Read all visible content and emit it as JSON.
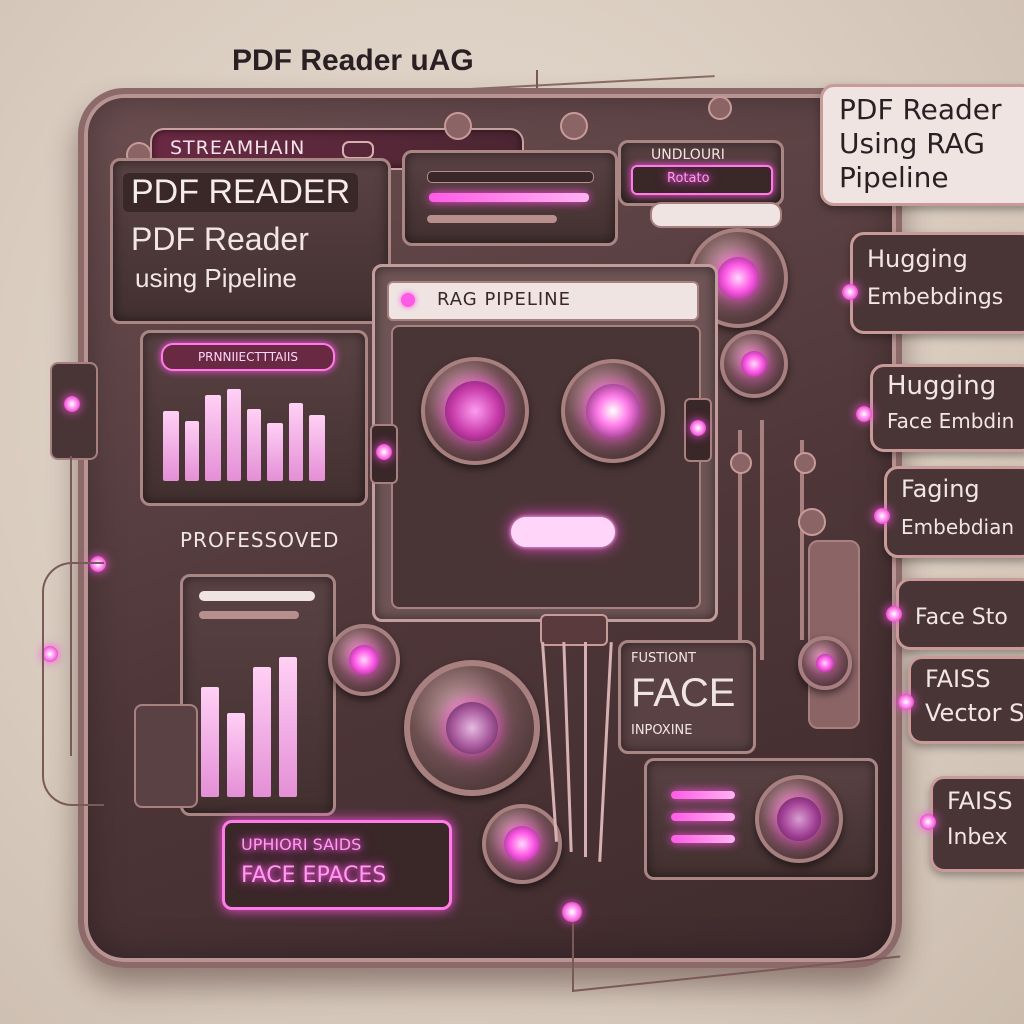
{
  "top_title": "PDF Reader uAG",
  "header": {
    "brand": "STREAMHAIN"
  },
  "title_panel": {
    "line1": "PDF READER",
    "line2": "PDF Reader",
    "line3": "using Pipeline"
  },
  "info_panel": {
    "label": "UNDLOURI",
    "button": "Rotato"
  },
  "rag_window": {
    "title": "RAG PIPELINE"
  },
  "left_widget": {
    "header": "PRNNIIECTTTAIIS",
    "label": "PROFESSOVED"
  },
  "face_panel": {
    "caption": "FUSTIONT",
    "word": "FACE",
    "sub": "INPOXINE"
  },
  "bottom_label": {
    "line1": "UPHIORI SAIDS",
    "line2": "FACE EPACES"
  },
  "side_tags": [
    {
      "line1": "PDF Reader",
      "line2": "Using RAG",
      "line3": "Pipeline"
    },
    {
      "line1": "Hugging",
      "line2": "Embebdings"
    },
    {
      "line1": "Hugging",
      "line2": "Face Embdin"
    },
    {
      "line1": "Faging",
      "line2": "Embebdian"
    },
    {
      "line1": "Face Sto"
    },
    {
      "line1": "FAISS",
      "line2": "Vector S"
    },
    {
      "line1": "FAISS",
      "line2": "Inbex"
    }
  ],
  "colors": {
    "neon": "#ff4fe0",
    "body": "#4f3739",
    "bezel": "#b89492",
    "background": "#d9ccbf"
  }
}
